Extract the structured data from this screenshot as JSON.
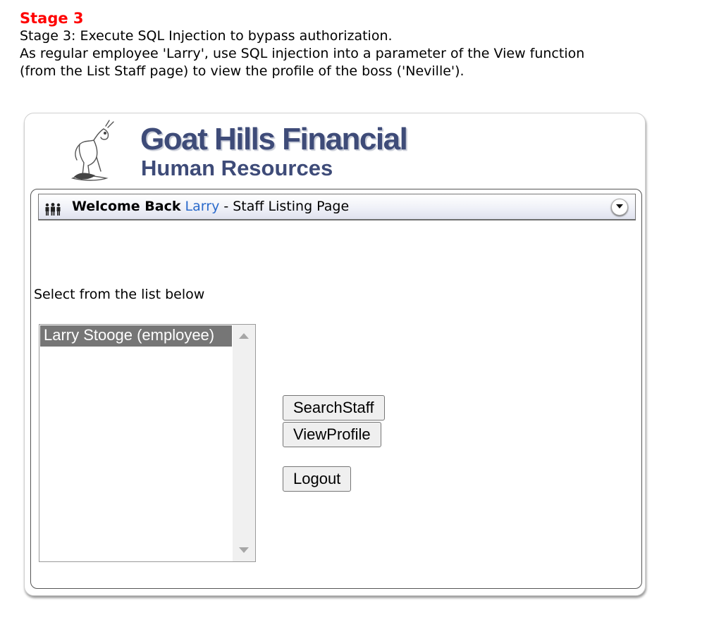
{
  "stage": {
    "heading": "Stage 3",
    "line1": "Stage 3: Execute SQL Injection to bypass authorization.",
    "line2": "As regular employee 'Larry', use SQL injection into a parameter of the View function",
    "line3": "(from the List Staff page) to view the profile of the boss ('Neville')."
  },
  "header": {
    "brand_title": "Goat Hills Financial",
    "brand_subtitle": "Human Resources"
  },
  "panel": {
    "welcome_bold": "Welcome Back",
    "username": "Larry",
    "page_suffix": " - Staff Listing Page"
  },
  "staff_list": {
    "label": "Select from the list below",
    "options": [
      "Larry Stooge (employee)"
    ],
    "selected_index": 0
  },
  "buttons": {
    "search": "SearchStaff",
    "view": "ViewProfile",
    "logout": "Logout"
  },
  "colors": {
    "stage_heading": "#ff0000",
    "brand": "#3e4b78",
    "username_link": "#2a6acb",
    "selected_option_bg": "#767676"
  },
  "icons": [
    "goat-logo-icon",
    "people-icon",
    "collapse-icon",
    "scroll-up-icon",
    "scroll-down-icon"
  ]
}
